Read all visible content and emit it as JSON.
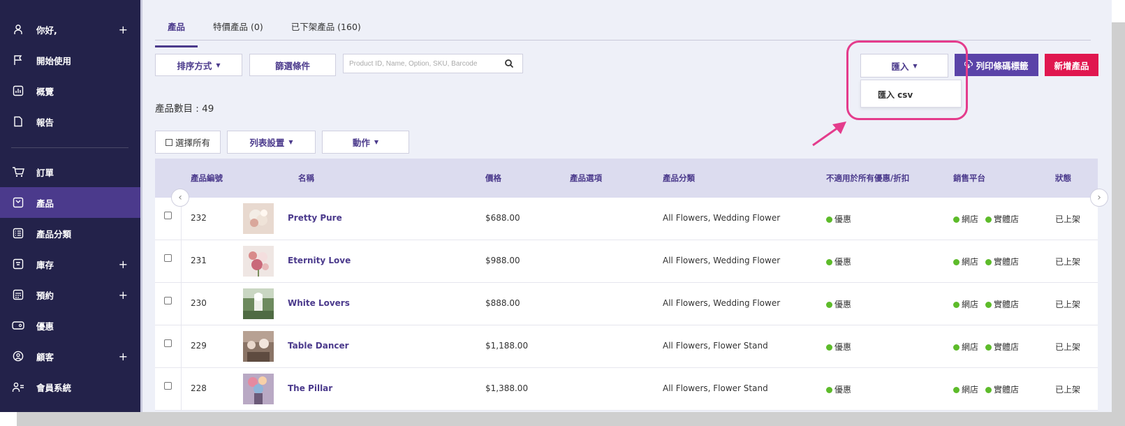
{
  "sidebar": {
    "items": [
      {
        "label": "你好,",
        "icon": "user-icon",
        "plus": "+"
      },
      {
        "label": "開始使用",
        "icon": "flag-icon",
        "plus": ""
      },
      {
        "label": "概覽",
        "icon": "chart-icon",
        "plus": ""
      },
      {
        "label": "報告",
        "icon": "document-icon",
        "plus": ""
      },
      {
        "label": "訂單",
        "icon": "cart-icon",
        "plus": ""
      },
      {
        "label": "產品",
        "icon": "product-icon",
        "plus": ""
      },
      {
        "label": "產品分類",
        "icon": "list-icon",
        "plus": ""
      },
      {
        "label": "庫存",
        "icon": "inventory-icon",
        "plus": "+"
      },
      {
        "label": "預約",
        "icon": "calendar-icon",
        "plus": "+"
      },
      {
        "label": "優惠",
        "icon": "coupon-icon",
        "plus": ""
      },
      {
        "label": "顧客",
        "icon": "customer-icon",
        "plus": "+"
      },
      {
        "label": "會員系統",
        "icon": "member-icon",
        "plus": ""
      }
    ],
    "active_index": 5
  },
  "tabs": [
    {
      "label": "產品"
    },
    {
      "label": "特價產品 (0)"
    },
    {
      "label": "已下架產品 (160)"
    }
  ],
  "toolbar": {
    "sort_label": "排序方式",
    "filter_label": "篩選條件",
    "search_placeholder": "Product ID, Name, Option, SKU, Barcode",
    "import_label": "匯入",
    "print_label": "列印條碼標籤",
    "add_label": "新增產品",
    "import_menu_item": "匯入 csv"
  },
  "product_count": "產品數目 : 49",
  "bulk": {
    "select_all": "選擇所有",
    "list_settings": "列表設置",
    "actions": "動作"
  },
  "table": {
    "headers": {
      "id": "產品編號",
      "name": "名稱",
      "price": "價格",
      "options": "產品選項",
      "category": "產品分類",
      "discount": "不適用於所有優惠/折扣",
      "channel": "銷售平台",
      "status": "狀態"
    },
    "rows": [
      {
        "id": "232",
        "name": "Pretty Pure",
        "price": "$688.00",
        "category": "All Flowers, Wedding Flower",
        "discount": "優惠",
        "channel_online": "網店",
        "channel_store": "實體店",
        "status": "已上架"
      },
      {
        "id": "231",
        "name": "Eternity Love",
        "price": "$988.00",
        "category": "All Flowers, Wedding Flower",
        "discount": "優惠",
        "channel_online": "網店",
        "channel_store": "實體店",
        "status": "已上架"
      },
      {
        "id": "230",
        "name": "White Lovers",
        "price": "$888.00",
        "category": "All Flowers, Wedding Flower",
        "discount": "優惠",
        "channel_online": "網店",
        "channel_store": "實體店",
        "status": "已上架"
      },
      {
        "id": "229",
        "name": "Table Dancer",
        "price": "$1,188.00",
        "category": "All Flowers, Flower Stand",
        "discount": "優惠",
        "channel_online": "網店",
        "channel_store": "實體店",
        "status": "已上架"
      },
      {
        "id": "228",
        "name": "The Pillar",
        "price": "$1,388.00",
        "category": "All Flowers, Flower Stand",
        "discount": "優惠",
        "channel_online": "網店",
        "channel_store": "實體店",
        "status": "已上架"
      }
    ]
  },
  "colors": {
    "sidebar_bg": "#23224a",
    "accent": "#4b3a8c",
    "primary_button": "#5a43a8",
    "add_button": "#e0174f",
    "highlight": "#e43c8c",
    "status_dot": "#5dbb2a"
  }
}
